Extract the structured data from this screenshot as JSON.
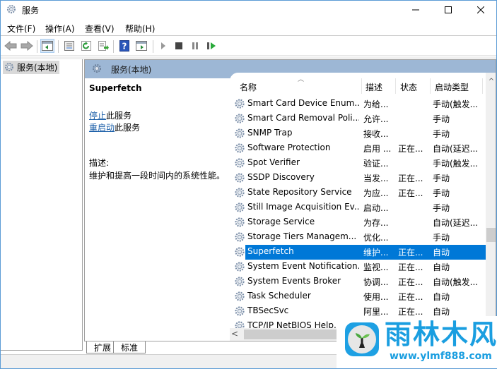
{
  "window": {
    "title": "服务",
    "controls": {
      "minimize": "minimize",
      "maximize": "maximize",
      "close": "close"
    }
  },
  "menu": [
    {
      "label": "文件(F)"
    },
    {
      "label": "操作(A)"
    },
    {
      "label": "查看(V)"
    },
    {
      "label": "帮助(H)"
    }
  ],
  "toolbar": {
    "buttons": [
      {
        "icon": "back-arrow-icon"
      },
      {
        "icon": "forward-arrow-icon"
      },
      {
        "icon": "show-hide-console-tree-icon",
        "active": true
      },
      {
        "icon": "properties-icon"
      },
      {
        "icon": "refresh-icon"
      },
      {
        "icon": "export-list-icon"
      },
      {
        "icon": "help-icon"
      },
      {
        "icon": "show-hide-action-pane-icon"
      },
      {
        "icon": "start-service-icon"
      },
      {
        "icon": "stop-service-icon"
      },
      {
        "icon": "pause-service-icon"
      },
      {
        "icon": "restart-service-icon"
      }
    ]
  },
  "tree": {
    "items": [
      {
        "label": "服务(本地)",
        "selected": true
      }
    ]
  },
  "content": {
    "header": "服务(本地)",
    "detail": {
      "title": "Superfetch",
      "stop_link": "停止",
      "stop_suffix": "此服务",
      "restart_link": "重启动",
      "restart_suffix": "此服务",
      "desc_label": "描述:",
      "desc_text": "维护和提高一段时间内的系统性能。"
    },
    "columns": [
      {
        "label": "名称",
        "sorted": "ascending"
      },
      {
        "label": "描述"
      },
      {
        "label": "状态"
      },
      {
        "label": "启动类型"
      }
    ],
    "rows": [
      {
        "name": "Smart Card Device Enum...",
        "desc": "为给...",
        "status": "",
        "startup": "手动(触发..."
      },
      {
        "name": "Smart Card Removal Poli...",
        "desc": "允许...",
        "status": "",
        "startup": "手动"
      },
      {
        "name": "SNMP Trap",
        "desc": "接收...",
        "status": "",
        "startup": "手动"
      },
      {
        "name": "Software Protection",
        "desc": "启用 ...",
        "status": "正在...",
        "startup": "自动(延迟..."
      },
      {
        "name": "Spot Verifier",
        "desc": "验证...",
        "status": "",
        "startup": "手动(触发..."
      },
      {
        "name": "SSDP Discovery",
        "desc": "当发...",
        "status": "正在...",
        "startup": "手动"
      },
      {
        "name": "State Repository Service",
        "desc": "为应...",
        "status": "正在...",
        "startup": "手动"
      },
      {
        "name": "Still Image Acquisition Ev...",
        "desc": "启动...",
        "status": "",
        "startup": "手动"
      },
      {
        "name": "Storage Service",
        "desc": "为存...",
        "status": "",
        "startup": "自动(延迟..."
      },
      {
        "name": "Storage Tiers Managem...",
        "desc": "优化...",
        "status": "",
        "startup": "手动"
      },
      {
        "name": "Superfetch",
        "desc": "维护...",
        "status": "正在...",
        "startup": "自动",
        "selected": true
      },
      {
        "name": "System Event Notification...",
        "desc": "监视...",
        "status": "正在...",
        "startup": "自动"
      },
      {
        "name": "System Events Broker",
        "desc": "协调...",
        "status": "正在...",
        "startup": "自动(触发..."
      },
      {
        "name": "Task Scheduler",
        "desc": "使用...",
        "status": "正在...",
        "startup": "自动"
      },
      {
        "name": "TBSecSvc",
        "desc": "阿里...",
        "status": "正在...",
        "startup": "自动"
      },
      {
        "name": "TCP/IP NetBIOS Help...",
        "desc": "",
        "status": "",
        "startup": ""
      }
    ],
    "scroll": {
      "vertical_up": "^",
      "horizontal_left": "<"
    }
  },
  "tabs": [
    {
      "label": "扩展",
      "active": true
    },
    {
      "label": "标准"
    }
  ],
  "watermark": {
    "title": "雨林木风",
    "url": "www.ylmf888.com"
  }
}
